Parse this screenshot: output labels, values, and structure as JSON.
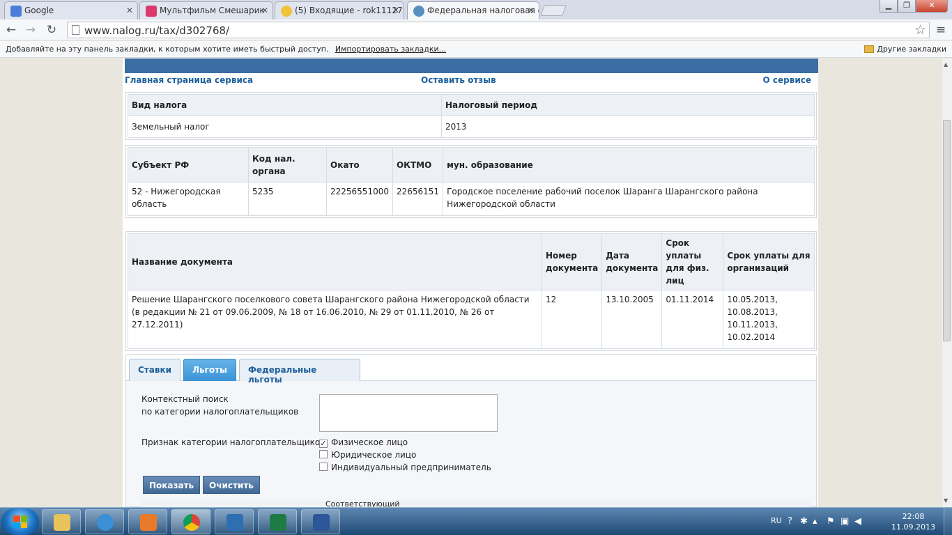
{
  "browser": {
    "tabs": [
      {
        "title": "Google",
        "fav_color": "#4a7ed8",
        "active": false
      },
      {
        "title": "Мультфильм Смешарик",
        "fav_color": "#d93a6b",
        "active": false
      },
      {
        "title": "(5) Входящие - rok11127",
        "fav_color": "#f0c43a",
        "active": false
      },
      {
        "title": "Федеральная налоговая с",
        "fav_color": "#5a8fc2",
        "active": true
      }
    ],
    "url": "www.nalog.ru/tax/d302768/",
    "bookmarks_text": "Добавляйте на эту панель закладки, к которым хотите иметь быстрый доступ.",
    "bookmarks_import": "Импортировать закладки...",
    "other_bookmarks": "Другие закладки"
  },
  "subnav": {
    "home": "Главная страница сервиса",
    "feedback": "Оставить отзыв",
    "about": "О сервисе"
  },
  "tax_table": {
    "headers": [
      "Вид налога",
      "Налоговый период"
    ],
    "row": [
      "Земельный налог",
      "2013"
    ]
  },
  "region_table": {
    "headers": [
      "Субъект РФ",
      "Код нал. органа",
      "Окато",
      "ОКТМО",
      "мун. образование"
    ],
    "row": [
      "52 - Нижегородская область",
      "5235",
      "22256551000",
      "22656151",
      "Городское поселение рабочий поселок Шаранга Шарангского района Нижегородской области"
    ]
  },
  "doc_table": {
    "headers": [
      "Название документа",
      "Номер документа",
      "Дата документа",
      "Срок уплаты для физ. лиц",
      "Срок уплаты для организаций"
    ],
    "row": {
      "name": "Решение Шарангского поселкового совета Шарангского района Нижегородской области (в редакции № 21 от 09.06.2009, № 18 от 16.06.2010, № 29 от 01.11.2010, № 26 от 27.12.2011)",
      "number": "12",
      "date": "13.10.2005",
      "pay_phys": "01.11.2014",
      "pay_org": [
        "10.05.2013,",
        "10.08.2013,",
        "10.11.2013,",
        "10.02.2014"
      ]
    }
  },
  "panel": {
    "tabs": [
      "Ставки",
      "Льготы",
      "Федеральные льготы"
    ],
    "active_tab": "Льготы",
    "search_label_1": "Контекстный поиск",
    "search_label_2": "по категории налогоплательщиков",
    "category_label": "Признак категории налогоплательщиков",
    "checkboxes": [
      {
        "label": "Физическое лицо",
        "checked": true
      },
      {
        "label": "Юридическое лицо",
        "checked": false
      },
      {
        "label": "Индивидуальный предприниматель",
        "checked": false
      }
    ],
    "show_button": "Показать",
    "clear_button": "Очистить",
    "grid_header_partial": "Соответствующий"
  },
  "taskbar": {
    "lang": "RU",
    "time": "22:08",
    "date": "11.09.2013"
  }
}
